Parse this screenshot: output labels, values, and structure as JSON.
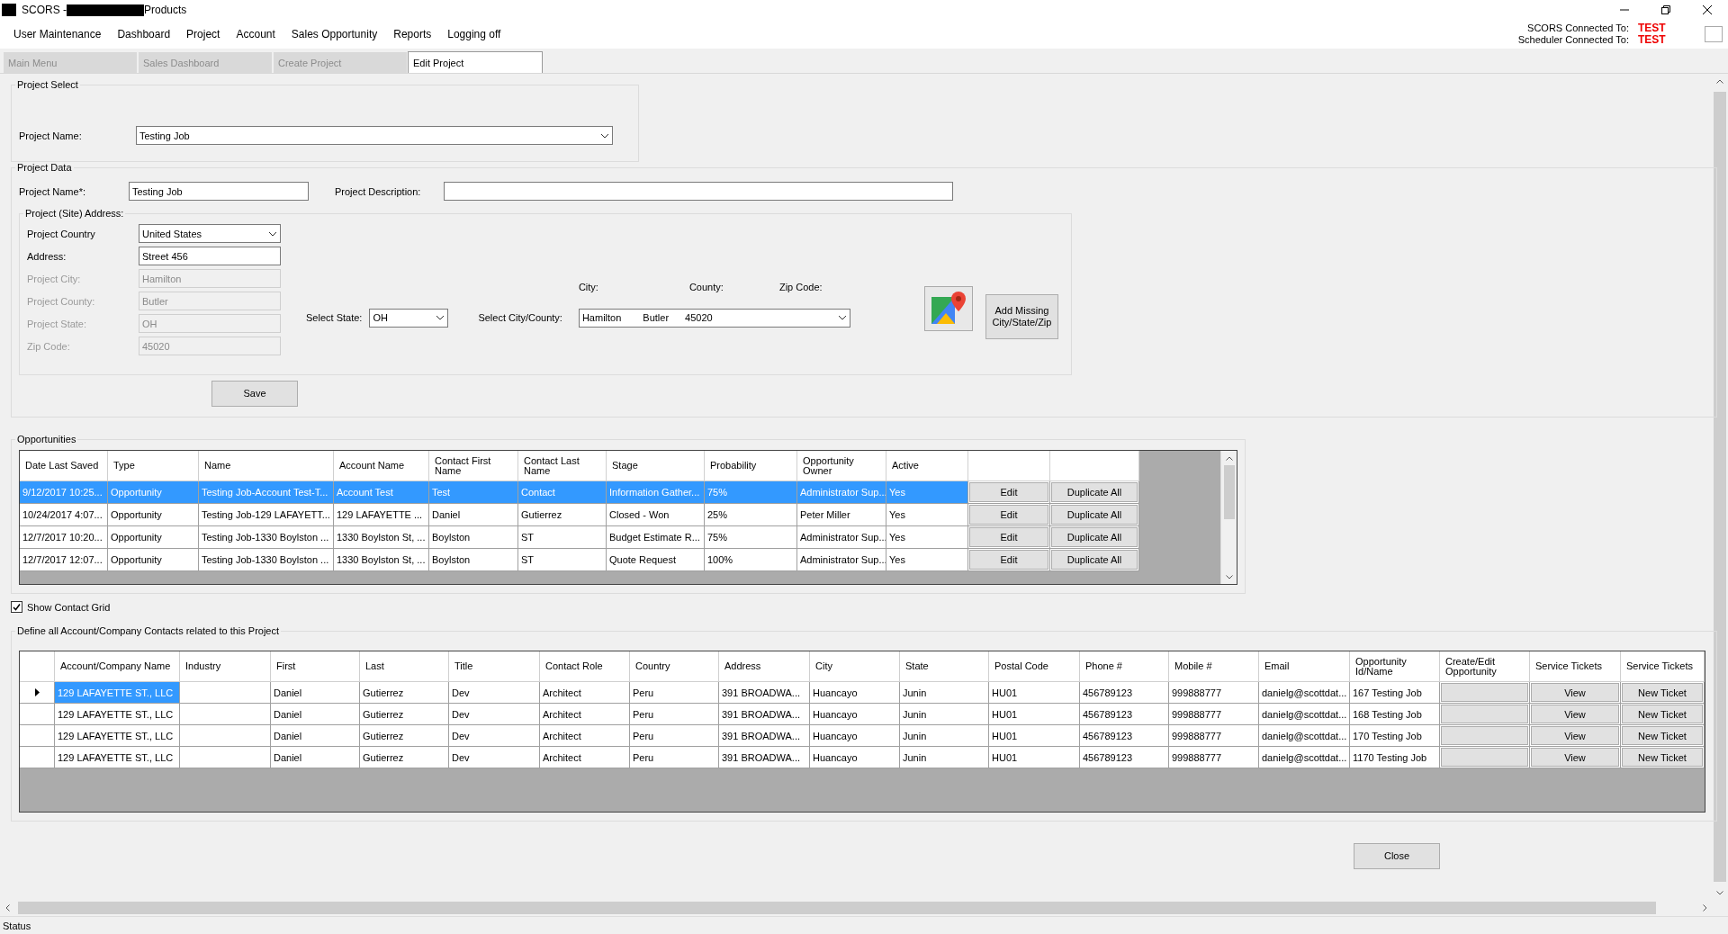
{
  "window": {
    "title_prefix": "SCORS -",
    "title_suffix": "Products"
  },
  "menu": [
    "User Maintenance",
    "Dashboard",
    "Project",
    "Account",
    "Sales Opportunity",
    "Reports",
    "Logging off"
  ],
  "connection": [
    {
      "label": "SCORS Connected To:",
      "value": "TEST"
    },
    {
      "label": "Scheduler Connected To:",
      "value": "TEST"
    }
  ],
  "tabs": [
    {
      "label": "Main Menu",
      "selected": false
    },
    {
      "label": "Sales Dashboard",
      "selected": false
    },
    {
      "label": "Create Project",
      "selected": false
    },
    {
      "label": "Edit Project",
      "selected": true
    }
  ],
  "project_select": {
    "title": "Project Select",
    "label": "Project Name:",
    "value": "Testing Job"
  },
  "project_data": {
    "title": "Project Data",
    "name_label": "Project Name*:",
    "name_value": "Testing Job",
    "description_label": "Project Description:",
    "address": {
      "title": "Project (Site) Address:",
      "fields": [
        {
          "label": "Project Country",
          "value": "United States",
          "kind": "dropdown",
          "disabled": false
        },
        {
          "label": "Address:",
          "value": "Street 456",
          "kind": "text",
          "disabled": false
        },
        {
          "label": "Project City:",
          "value": "Hamilton",
          "kind": "text",
          "disabled": true
        },
        {
          "label": "Project County:",
          "value": "Butler",
          "kind": "text",
          "disabled": true
        },
        {
          "label": "Project State:",
          "value": "OH",
          "kind": "text",
          "disabled": true
        },
        {
          "label": "Zip Code:",
          "value": "45020",
          "kind": "text",
          "disabled": true
        }
      ],
      "state_label": "Select State:",
      "state_value": "OH",
      "city_label": "Select City/County:",
      "city_headers": [
        "City:",
        "County:",
        "Zip Code:"
      ],
      "city_values": [
        "Hamilton",
        "Butler",
        "45020"
      ],
      "add_missing_button": "Add Missing City/State/Zip"
    },
    "save_button": "Save"
  },
  "opportunities": {
    "title": "Opportunities",
    "columns": [
      "Date Last Saved",
      "Type",
      "Name",
      "Account Name",
      "Contact First Name",
      "Contact Last Name",
      "Stage",
      "Probability",
      "Opportunity Owner",
      "Active"
    ],
    "rows": [
      {
        "selected": true,
        "cells": [
          "9/12/2017 10:25...",
          "Opportunity",
          "Testing Job-Account Test-T...",
          "Account Test",
          "Test",
          "Contact",
          "Information Gather...",
          "75%",
          "Administrator Sup...",
          "Yes"
        ],
        "buttons": [
          "Edit",
          "Duplicate All"
        ]
      },
      {
        "selected": false,
        "cells": [
          "10/24/2017 4:07...",
          "Opportunity",
          "Testing Job-129 LAFAYETT...",
          "129 LAFAYETTE ...",
          "Daniel",
          "Gutierrez",
          "Closed - Won",
          "25%",
          "Peter Miller",
          "Yes"
        ],
        "buttons": [
          "Edit",
          "Duplicate All"
        ]
      },
      {
        "selected": false,
        "cells": [
          "12/7/2017 10:20...",
          "Opportunity",
          "Testing Job-1330 Boylston ...",
          "1330 Boylston St, ...",
          "Boylston",
          "ST",
          "Budget Estimate R...",
          "75%",
          "Administrator Sup...",
          "Yes"
        ],
        "buttons": [
          "Edit",
          "Duplicate All"
        ]
      },
      {
        "selected": false,
        "cells": [
          "12/7/2017 12:07...",
          "Opportunity",
          "Testing Job-1330 Boylston ...",
          "1330 Boylston St, ...",
          "Boylston",
          "ST",
          "Quote Request",
          "100%",
          "Administrator Sup...",
          "Yes"
        ],
        "buttons": [
          "Edit",
          "Duplicate All"
        ]
      }
    ]
  },
  "show_contact_grid": {
    "label": "Show Contact Grid",
    "checked": true
  },
  "contacts": {
    "title": "Define all Account/Company Contacts related to this Project",
    "columns": [
      "Account/Company Name",
      "Industry",
      "First",
      "Last",
      "Title",
      "Contact Role",
      "Country",
      "Address",
      "City",
      "State",
      "Postal Code",
      "Phone #",
      "Mobile #",
      "Email",
      "Opportunity Id/Name",
      "Create/Edit Opportunity",
      "Service Tickets",
      "Service Tickets"
    ],
    "rows": [
      {
        "current": true,
        "selected": true,
        "cells": [
          "129 LAFAYETTE ST., LLC",
          "",
          "Daniel",
          "Gutierrez",
          "Dev",
          "Architect",
          "Peru",
          "391 BROADWA...",
          "Huancayo",
          "Junin",
          "HU01",
          "456789123",
          "999888777",
          "danielg@scottdat...",
          "167 Testing Job"
        ],
        "buttons": [
          "View",
          "New Ticket"
        ]
      },
      {
        "current": false,
        "selected": false,
        "cells": [
          "129 LAFAYETTE ST., LLC",
          "",
          "Daniel",
          "Gutierrez",
          "Dev",
          "Architect",
          "Peru",
          "391 BROADWA...",
          "Huancayo",
          "Junin",
          "HU01",
          "456789123",
          "999888777",
          "danielg@scottdat...",
          "168 Testing Job"
        ],
        "buttons": [
          "View",
          "New Ticket"
        ]
      },
      {
        "current": false,
        "selected": false,
        "cells": [
          "129 LAFAYETTE ST., LLC",
          "",
          "Daniel",
          "Gutierrez",
          "Dev",
          "Architect",
          "Peru",
          "391 BROADWA...",
          "Huancayo",
          "Junin",
          "HU01",
          "456789123",
          "999888777",
          "danielg@scottdat...",
          "170 Testing Job"
        ],
        "buttons": [
          "View",
          "New Ticket"
        ]
      },
      {
        "current": false,
        "selected": false,
        "cells": [
          "129 LAFAYETTE ST., LLC",
          "",
          "Daniel",
          "Gutierrez",
          "Dev",
          "Architect",
          "Peru",
          "391 BROADWA...",
          "Huancayo",
          "Junin",
          "HU01",
          "456789123",
          "999888777",
          "danielg@scottdat...",
          "1170 Testing Job"
        ],
        "buttons": [
          "View",
          "New Ticket"
        ]
      }
    ]
  },
  "close_button": "Close",
  "status_bar": "Status"
}
